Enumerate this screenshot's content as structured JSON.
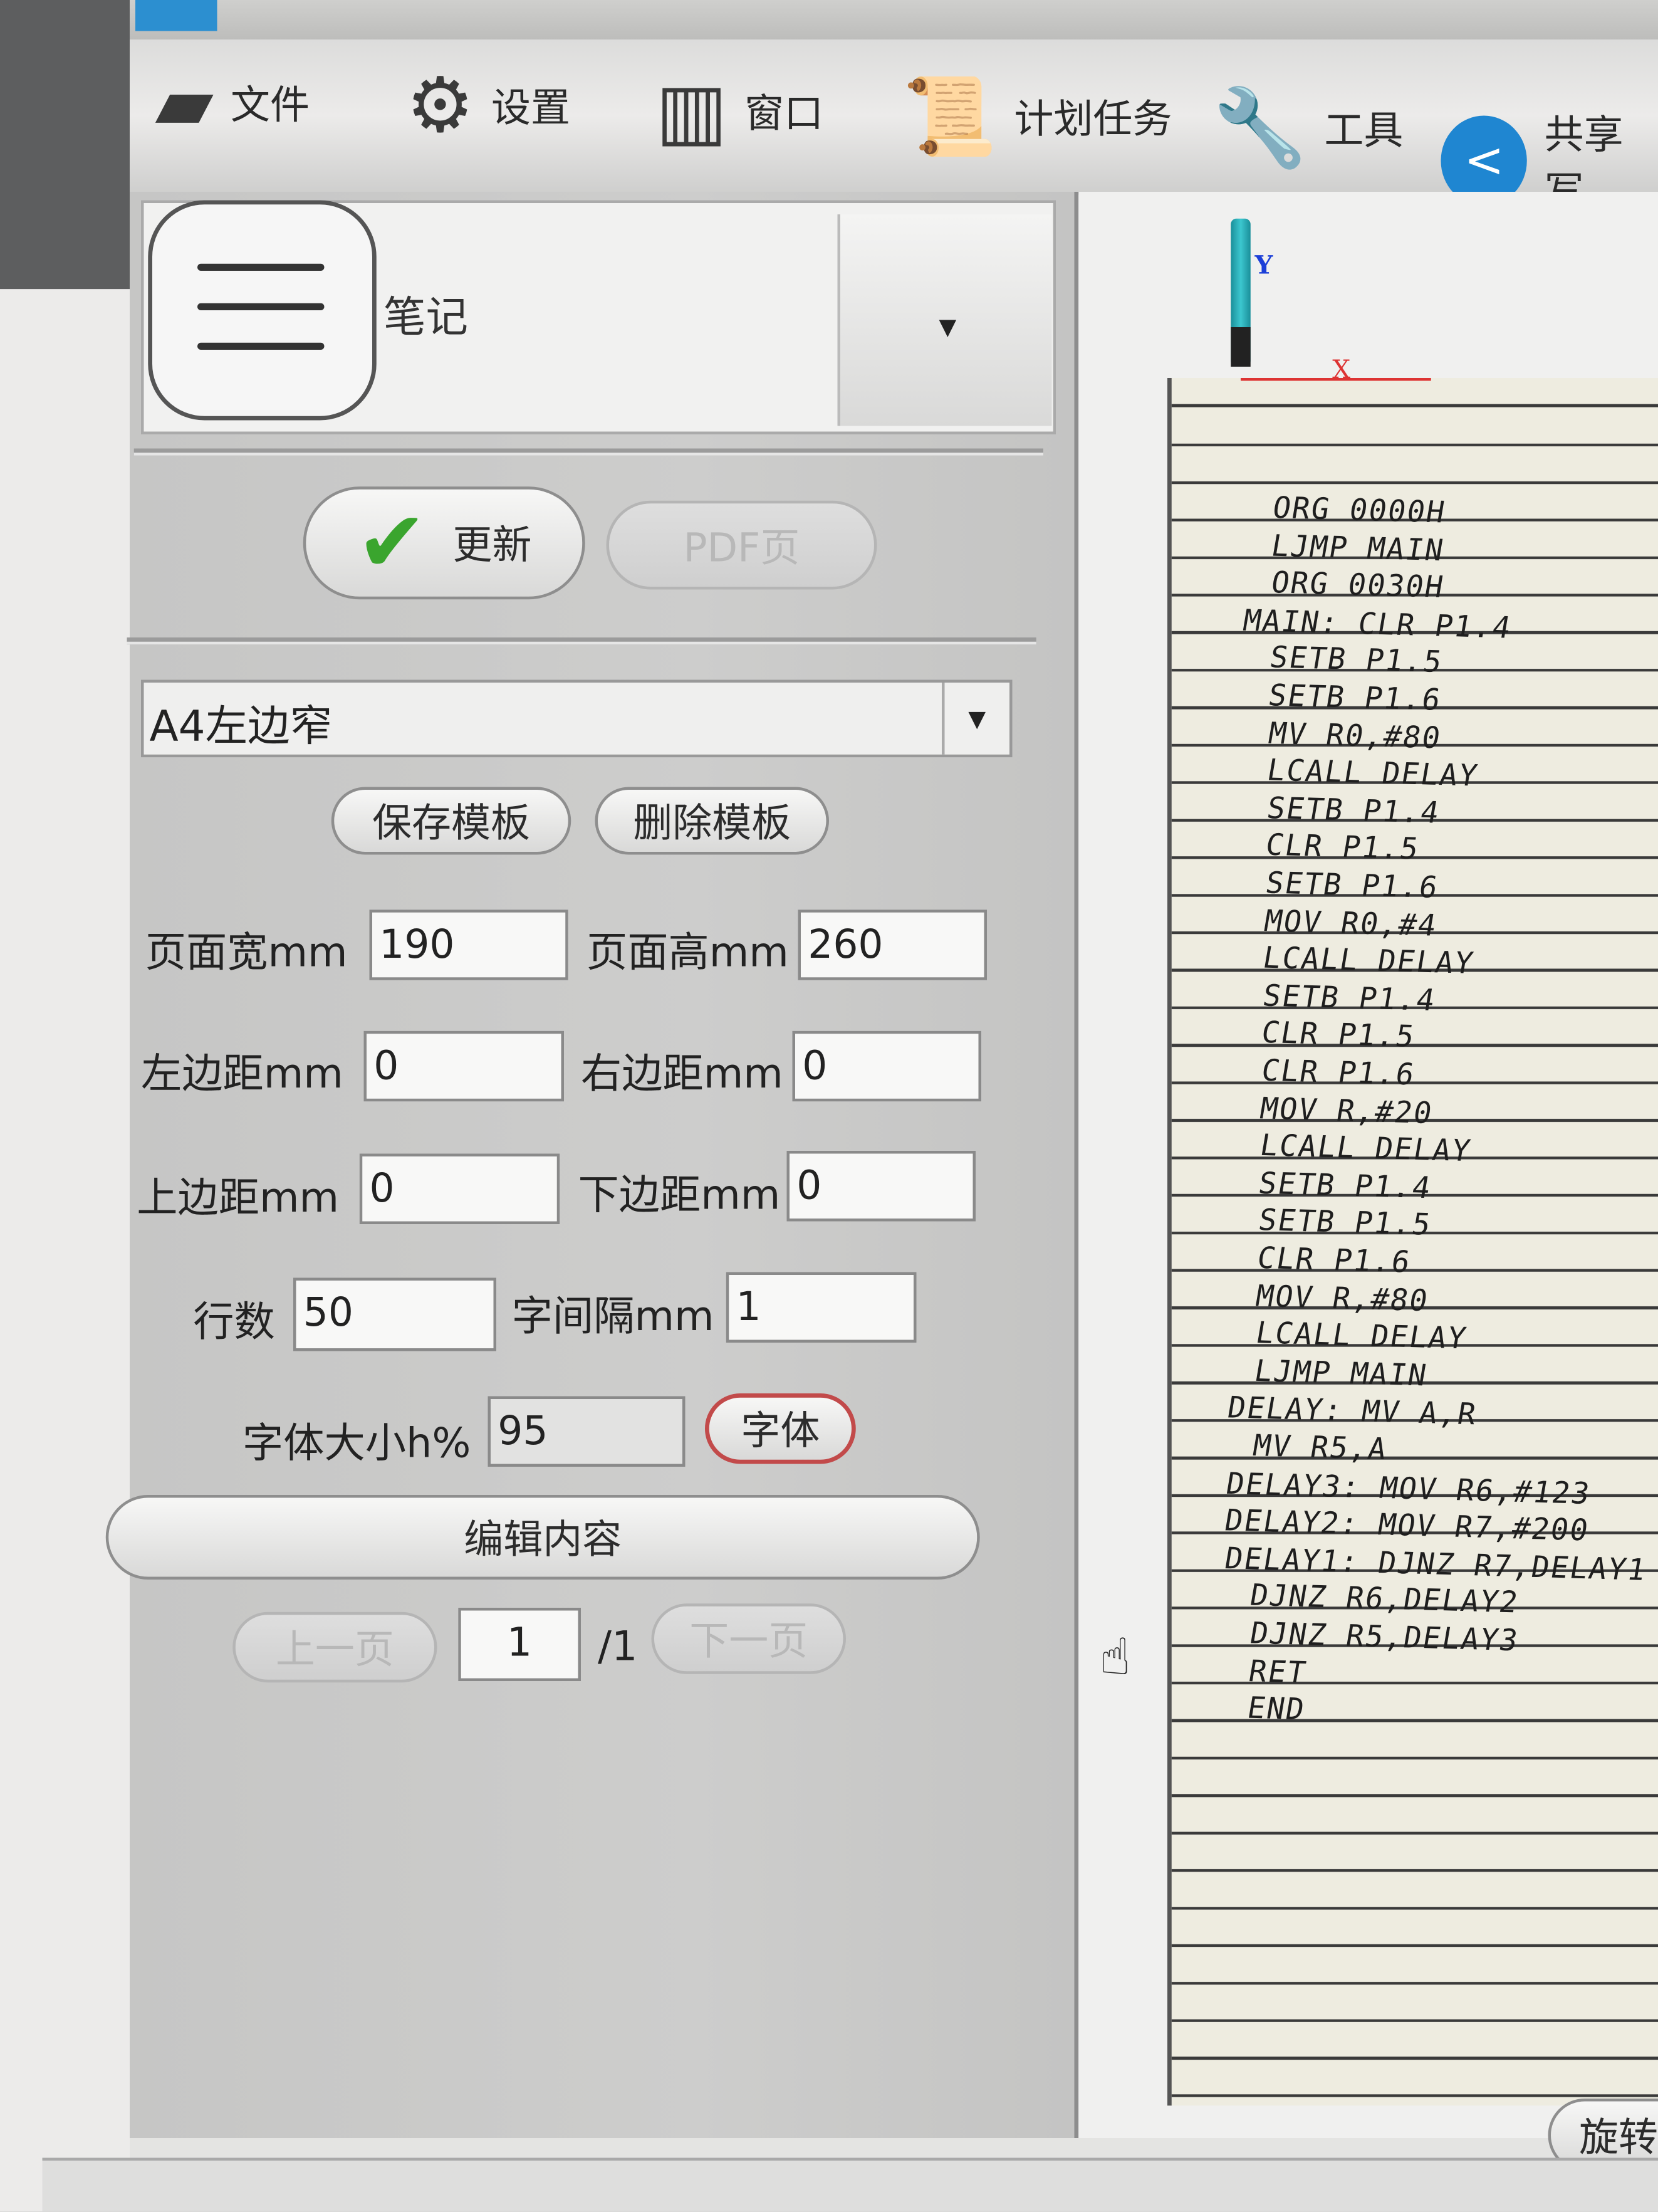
{
  "toolbar": {
    "items": [
      {
        "label": "文件",
        "icon": "folder-icon"
      },
      {
        "label": "设置",
        "icon": "gear-icon"
      },
      {
        "label": "窗口",
        "icon": "window-icon"
      },
      {
        "label": "计划任务",
        "icon": "scroll-icon"
      },
      {
        "label": "工具",
        "icon": "wrench-icon"
      },
      {
        "label": "共享写",
        "icon": "share-icon"
      }
    ]
  },
  "notes": {
    "label": "笔记"
  },
  "actions": {
    "update": "更新",
    "pdf": "PDF页"
  },
  "template": {
    "selected": "A4左边窄",
    "save": "保存模板",
    "delete": "删除模板"
  },
  "fields": {
    "page_width": {
      "label": "页面宽mm",
      "value": "190"
    },
    "page_height": {
      "label": "页面高mm",
      "value": "260"
    },
    "margin_left": {
      "label": "左边距mm",
      "value": "0"
    },
    "margin_right": {
      "label": "右边距mm",
      "value": "0"
    },
    "margin_top": {
      "label": "上边距mm",
      "value": "0"
    },
    "margin_bottom": {
      "label": "下边距mm",
      "value": "0"
    },
    "rows": {
      "label": "行数",
      "value": "50"
    },
    "char_spacing": {
      "label": "字间隔mm",
      "value": "1"
    },
    "font_size": {
      "label": "字体大小h%",
      "value": "95"
    },
    "font_button": "字体"
  },
  "edit_content": "编辑内容",
  "pagination": {
    "prev": "上一页",
    "current": "1",
    "total": "/1",
    "next": "下一页"
  },
  "canvas": {
    "y_label": "Y",
    "x_label": "X",
    "accent_y": "#1b3fd8",
    "accent_x": "#dd3333",
    "lines": [
      "ORG 0000H",
      "LJMP MAIN",
      "ORG 0030H",
      "MAIN: CLR P1.4",
      "SETB P1.5",
      "SETB P1.6",
      "MV R0,#80",
      "LCALL DELAY",
      "SETB P1.4",
      "CLR P1.5",
      "SETB P1.6",
      "MOV R0,#4",
      "LCALL DELAY",
      "SETB P1.4",
      "CLR P1.5",
      "CLR P1.6",
      "MOV R,#20",
      "LCALL DELAY",
      "SETB P1.4",
      "SETB P1.5",
      "CLR P1.6",
      "MOV R,#80",
      "LCALL DELAY",
      "LJMP MAIN",
      "DELAY: MV A,R",
      "MV R5,A",
      "DELAY3: MOV R6,#123",
      "DELAY2: MOV R7,#200",
      "DELAY1: DJNZ R7,DELAY1",
      "DJNZ R6,DELAY2",
      "DJNZ R5,DELAY3",
      "RET",
      "END"
    ]
  },
  "rotate_button": "旋转"
}
